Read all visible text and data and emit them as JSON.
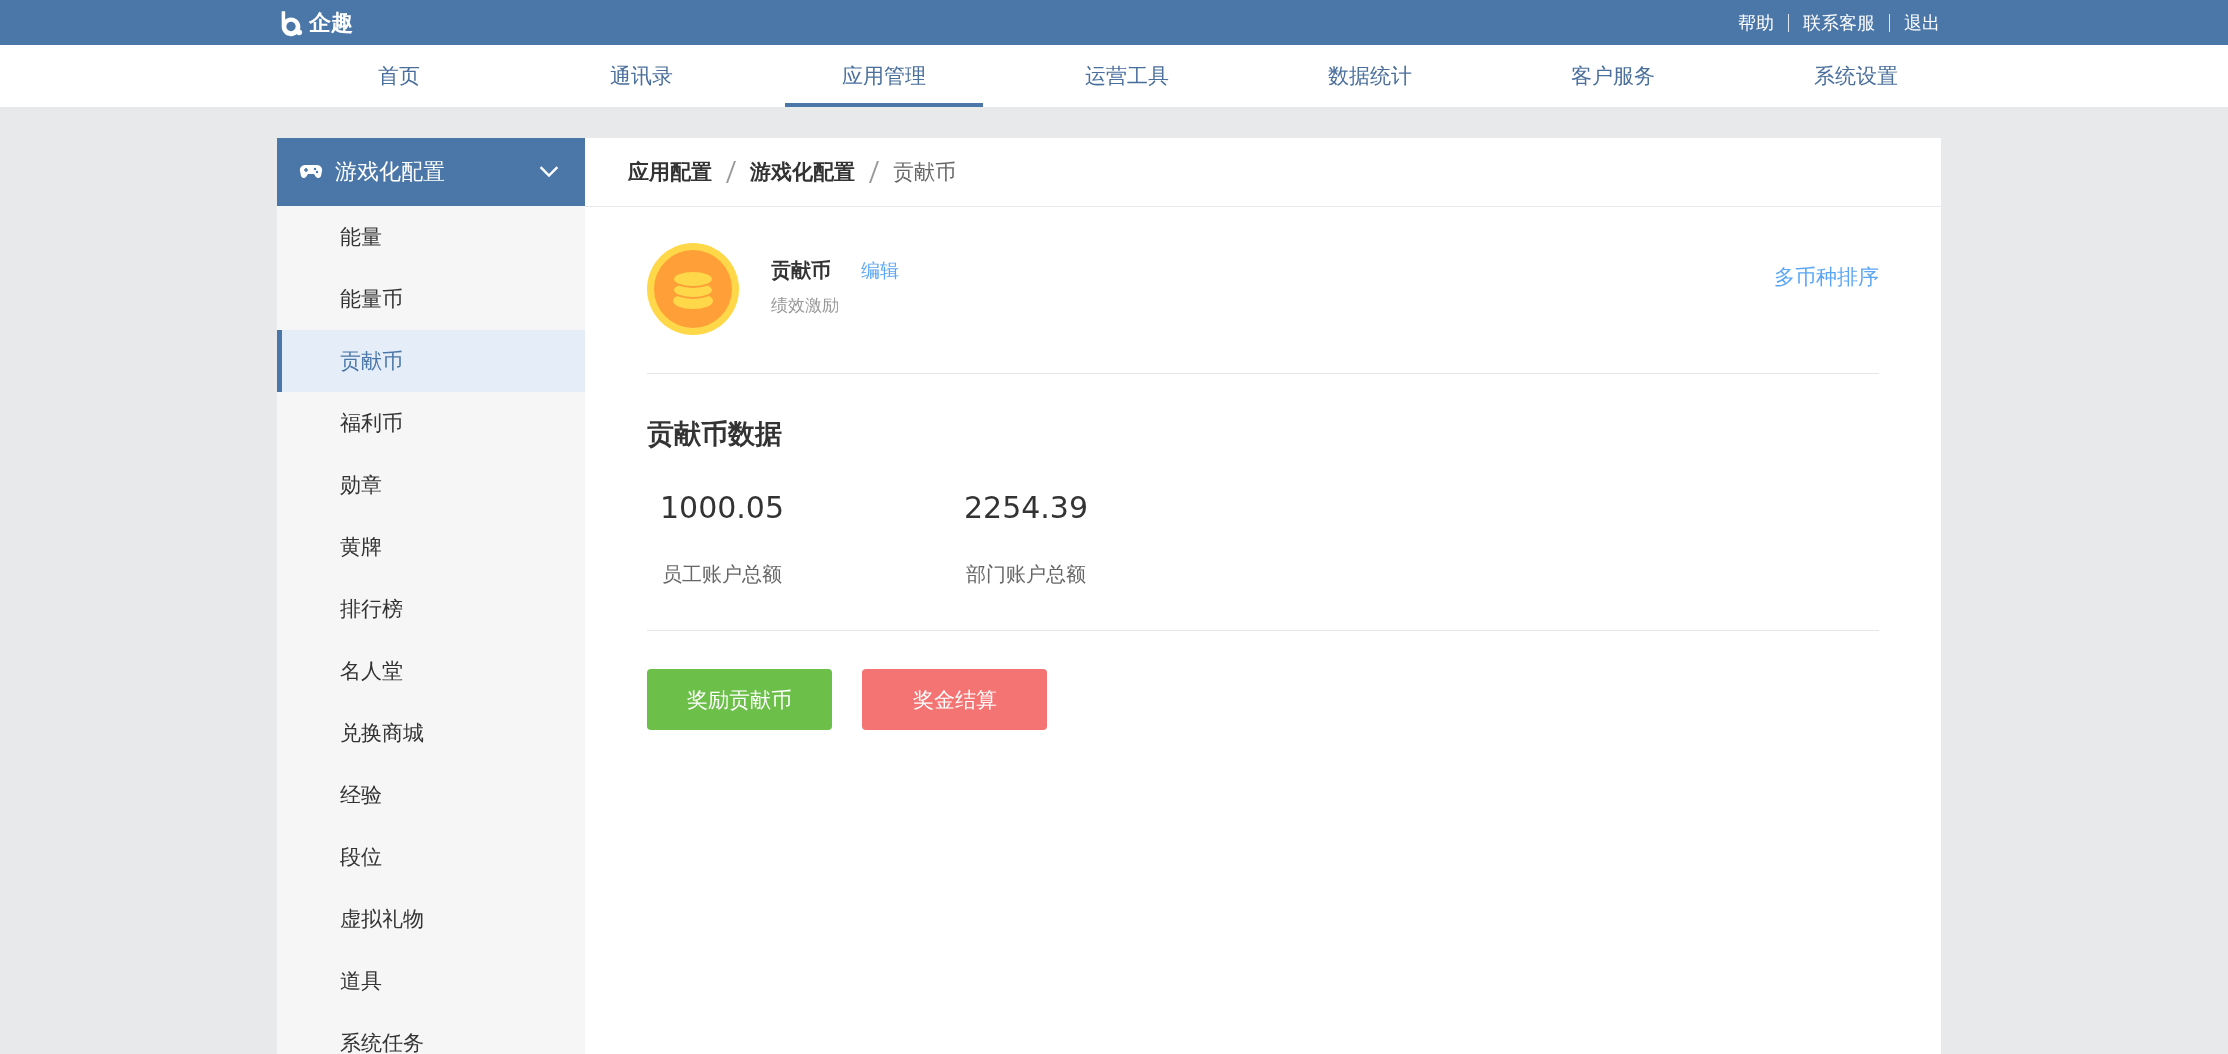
{
  "header": {
    "logo_text": "企趣",
    "links": [
      "帮助",
      "联系客服",
      "退出"
    ]
  },
  "nav": [
    {
      "label": "首页",
      "selected": false
    },
    {
      "label": "通讯录",
      "selected": false
    },
    {
      "label": "应用管理",
      "selected": true
    },
    {
      "label": "运营工具",
      "selected": false
    },
    {
      "label": "数据统计",
      "selected": false
    },
    {
      "label": "客户服务",
      "selected": false
    },
    {
      "label": "系统设置",
      "selected": false
    }
  ],
  "sidebar": {
    "group": {
      "label": "游戏化配置",
      "expanded": true
    },
    "items": [
      {
        "label": "能量",
        "selected": false
      },
      {
        "label": "能量币",
        "selected": false
      },
      {
        "label": "贡献币",
        "selected": true
      },
      {
        "label": "福利币",
        "selected": false
      },
      {
        "label": "勋章",
        "selected": false
      },
      {
        "label": "黄牌",
        "selected": false
      },
      {
        "label": "排行榜",
        "selected": false
      },
      {
        "label": "名人堂",
        "selected": false
      },
      {
        "label": "兑换商城",
        "selected": false
      },
      {
        "label": "经验",
        "selected": false
      },
      {
        "label": "段位",
        "selected": false
      },
      {
        "label": "虚拟礼物",
        "selected": false
      },
      {
        "label": "道具",
        "selected": false
      },
      {
        "label": "系统任务",
        "selected": false
      }
    ]
  },
  "breadcrumb": [
    "应用配置",
    "游戏化配置",
    "贡献币"
  ],
  "coin": {
    "name": "贡献币",
    "edit_link": "编辑",
    "subtitle": "绩效激励",
    "sort_link": "多币种排序"
  },
  "stats": {
    "title": "贡献币数据",
    "items": [
      {
        "value": "1000.05",
        "label": "员工账户总额"
      },
      {
        "value": "2254.39",
        "label": "部门账户总额"
      }
    ]
  },
  "buttons": [
    {
      "label": "奖励贡献币",
      "kind": "primary"
    },
    {
      "label": "奖金结算",
      "kind": "danger"
    }
  ]
}
